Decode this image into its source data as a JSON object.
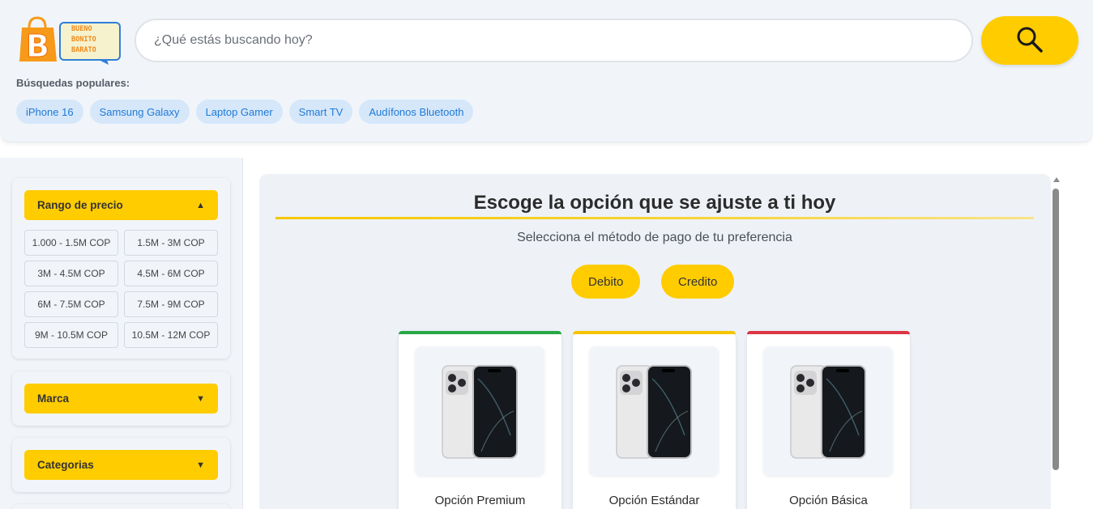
{
  "header": {
    "logo_text": [
      "BUENO",
      "BONITO",
      "BARATO"
    ],
    "search_placeholder": "¿Qué estás buscando hoy?",
    "popular_title": "Búsquedas populares:",
    "popular": [
      "iPhone 16",
      "Samsung Galaxy",
      "Laptop Gamer",
      "Smart TV",
      "Audífonos Bluetooth"
    ]
  },
  "sidebar": {
    "price": {
      "label": "Rango de precio",
      "arrow": "▲",
      "ranges": [
        "1.000 - 1.5M COP",
        "1.5M - 3M COP",
        "3M - 4.5M COP",
        "4.5M - 6M COP",
        "6M - 7.5M COP",
        "7.5M - 9M COP",
        "9M - 10.5M COP",
        "10.5M - 12M COP"
      ]
    },
    "brand": {
      "label": "Marca",
      "arrow": "▼"
    },
    "categories": {
      "label": "Categorias",
      "arrow": "▼"
    }
  },
  "main": {
    "title": "Escoge la opción que se ajuste a ti hoy",
    "subtitle": "Selecciona el método de pago de tu preferencia",
    "payment_buttons": [
      "Debito",
      "Credito"
    ],
    "cards": [
      {
        "label": "Opción Premium",
        "accent": "#28a745"
      },
      {
        "label": "Opción Estándar",
        "accent": "#f5c400"
      },
      {
        "label": "Opción Básica",
        "accent": "#dc3545"
      }
    ]
  },
  "colors": {
    "accent": "#ffcc00",
    "chip_bg": "#d6e7fa",
    "chip_text": "#1e7ad6"
  },
  "icons": {
    "search": "search-icon",
    "product": "phone-image"
  }
}
